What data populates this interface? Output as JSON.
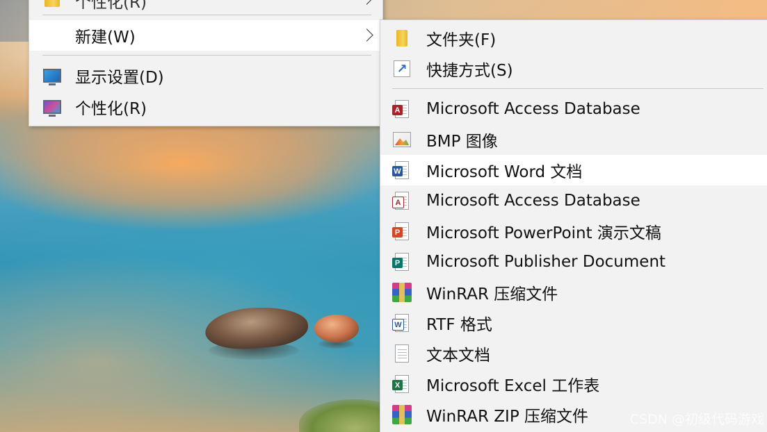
{
  "parent_menu": {
    "cut_off_item": "个性化(R)",
    "items": [
      {
        "label": "新建(W)",
        "icon": "none",
        "has_submenu": true,
        "highlighted": true
      },
      {
        "label": "显示设置(D)",
        "icon": "display-settings-icon"
      },
      {
        "label": "个性化(R)",
        "icon": "personalize-icon"
      }
    ]
  },
  "new_submenu": {
    "items": [
      {
        "label": "文件夹(F)",
        "icon": "folder-icon"
      },
      {
        "label": "快捷方式(S)",
        "icon": "shortcut-icon"
      },
      {
        "label": "Microsoft Access Database",
        "icon": "access-icon"
      },
      {
        "label": "BMP 图像",
        "icon": "bmp-image-icon"
      },
      {
        "label": "Microsoft Word 文档",
        "icon": "word-icon",
        "highlighted": true
      },
      {
        "label": "Microsoft Access Database",
        "icon": "access-icon"
      },
      {
        "label": "Microsoft PowerPoint 演示文稿",
        "icon": "powerpoint-icon"
      },
      {
        "label": "Microsoft Publisher Document",
        "icon": "publisher-icon"
      },
      {
        "label": "WinRAR 压缩文件",
        "icon": "winrar-icon"
      },
      {
        "label": "RTF 格式",
        "icon": "rtf-icon"
      },
      {
        "label": "文本文档",
        "icon": "text-document-icon"
      },
      {
        "label": "Microsoft Excel 工作表",
        "icon": "excel-icon"
      },
      {
        "label": "WinRAR ZIP 压缩文件",
        "icon": "winrar-zip-icon"
      }
    ]
  },
  "watermark": "CSDN @初级代码游戏",
  "colors": {
    "menu_bg": "#f2f2f2",
    "highlight_bg": "#ffffff",
    "access": "#a4262c",
    "word": "#2b579a",
    "powerpoint": "#d24726",
    "publisher": "#077568",
    "excel": "#217346"
  }
}
